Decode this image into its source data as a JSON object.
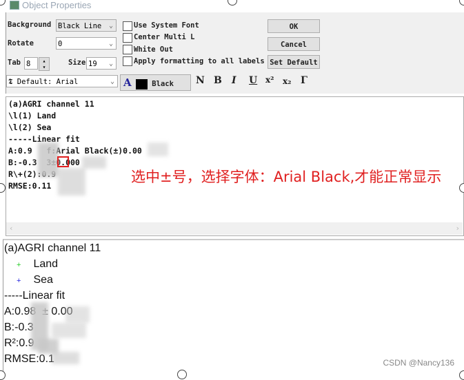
{
  "window": {
    "title": "Object Properties"
  },
  "controls": {
    "background_label": "Background",
    "background_value": "Black Line",
    "rotate_label": "Rotate",
    "rotate_value": "0",
    "tab_label": "Tab",
    "tab_value": "8",
    "size_label": "Size",
    "size_value": "19",
    "font_value": "Default: Arial",
    "color_value": "Black",
    "checkboxes": [
      {
        "label": "Use System Font",
        "checked": false
      },
      {
        "label": "Center Multi L",
        "checked": false
      },
      {
        "label": "White Out",
        "checked": false
      },
      {
        "label": "Apply formatting to all labels",
        "checked": false
      }
    ],
    "ok": "OK",
    "cancel": "Cancel",
    "set_default": "Set Default",
    "format_buttons": [
      "N",
      "B",
      "I",
      "U",
      "x²",
      "x₂",
      "Γ"
    ]
  },
  "editor": {
    "lines": [
      "(a)AGRI channel 11",
      "\\l(1) Land",
      "\\l(2) Sea",
      "-----Linear fit",
      "A:0.9   f:Arial Black(±)0.00",
      "B:-0.3  3±0.000",
      "R\\+(2):0.9",
      "RMSE:0.11"
    ]
  },
  "annotation": {
    "text": "选中±号，选择字体：Arial Black,才能正常显示",
    "color": "#e02020"
  },
  "preview": {
    "title": "(a)AGRI channel 11",
    "legend": [
      {
        "label": "Land",
        "color": "#22cc22"
      },
      {
        "label": "Sea",
        "color": "#2222dd"
      }
    ],
    "lines": [
      "-----Linear fit",
      "A:0.98  ± 0.00",
      "B:-0.3",
      "R²:0.9",
      "RMSE:0.1"
    ]
  },
  "watermark": "CSDN @Nancy136"
}
